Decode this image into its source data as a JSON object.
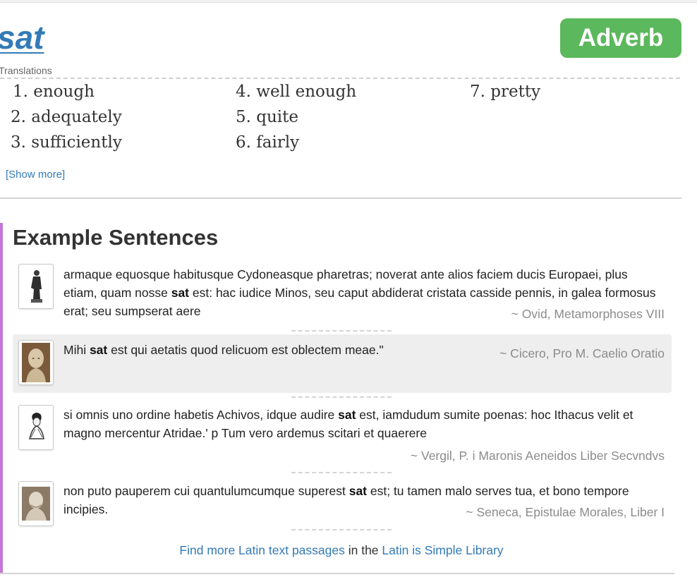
{
  "word": {
    "title": "sat",
    "part_of_speech": "Adverb",
    "part_of_speech_color": "#5cb85c"
  },
  "translations": {
    "label": "Translations",
    "items": [
      "1. enough",
      "2. adequately",
      "3. sufficiently",
      "4. well enough",
      "5. quite",
      "6. fairly",
      "7. pretty"
    ],
    "show_more": "[Show more]"
  },
  "examples": {
    "heading": "Example Sentences",
    "accent_color": "#c477d6",
    "sentences": [
      {
        "before": "armaque equosque habitusque Cydoneasque pharetras; noverat ante alios faciem ducis Europaei, plus etiam, quam nosse ",
        "keyword": "sat",
        "after": " est: hac iudice Minos, seu caput abdiderat cristata casside pennis, in galea formosus erat; seu sumpserat aere",
        "source": "~ Ovid, Metamorphoses VIII",
        "icon": "statue-icon"
      },
      {
        "before": "Mihi ",
        "keyword": "sat",
        "after": " est qui aetatis quod relicuom est oblectem meae.\"",
        "source": "~ Cicero, Pro M. Caelio Oratio",
        "icon": "bust-icon"
      },
      {
        "before": "si omnis uno ordine habetis Achivos, idque audire ",
        "keyword": "sat",
        "after": " est, iamdudum sumite poenas: hoc Ithacus velit et magno mercentur Atridae.' p Tum vero ardemus scitari et quaerere",
        "source": "~ Vergil, P. i Maronis Aeneidos Liber Secvndvs",
        "icon": "portrait-sketch-icon"
      },
      {
        "before": "non puto pauperem cui quantulumcumque superest ",
        "keyword": "sat",
        "after": " est; tu tamen malo serves tua, et bono tempore incipies.",
        "source": "~ Seneca, Epistulae Morales, Liber I",
        "icon": "bust-icon"
      }
    ]
  },
  "library": {
    "link1": "Find more Latin text passages",
    "middle": " in the ",
    "link2": "Latin is Simple Library"
  }
}
